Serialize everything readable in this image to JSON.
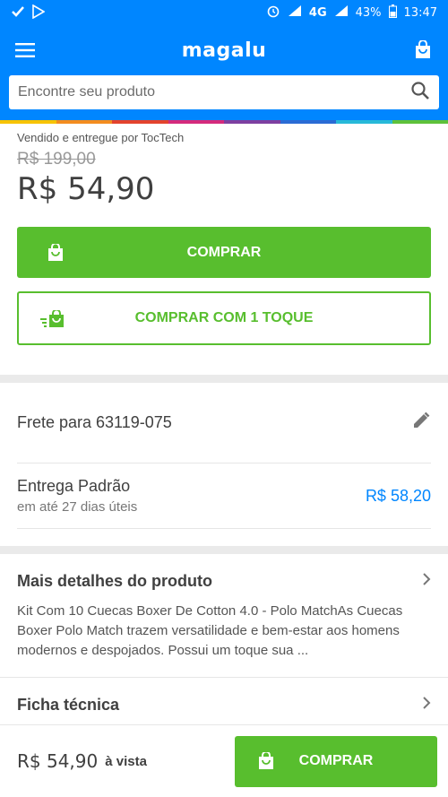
{
  "status_bar": {
    "network": "4G",
    "battery": "43%",
    "time": "13:47"
  },
  "header": {
    "logo": "magalu",
    "menu_icon": "hamburger-icon",
    "bag_icon": "shopping-bag-icon"
  },
  "search": {
    "placeholder": "Encontre seu produto"
  },
  "product": {
    "sold_by": "Vendido e entregue por TocTech",
    "old_price": "R$ 199,00",
    "price": "R$ 54,90",
    "buy_label": "COMPRAR",
    "one_touch_label": "COMPRAR COM 1 TOQUE"
  },
  "freight": {
    "label": "Frete para 63119-075",
    "delivery_title": "Entrega Padrão",
    "delivery_subtitle": "em até 27 dias úteis",
    "delivery_price": "R$ 58,20"
  },
  "details": {
    "title": "Mais detalhes do produto",
    "text": "Kit Com 10 Cuecas Boxer De Cotton 4.0 - Polo MatchAs Cuecas Boxer Polo Match trazem versatilidade e bem-estar aos homens modernos e despojados. Possui um toque sua  ..."
  },
  "tech_sheet": {
    "title": "Ficha técnica"
  },
  "bottom_bar": {
    "price": "R$ 54,90",
    "condition": "à vista",
    "buy_label": "COMPRAR"
  },
  "colors": {
    "brand_blue": "#0086ff",
    "buy_green": "#58be2e"
  }
}
